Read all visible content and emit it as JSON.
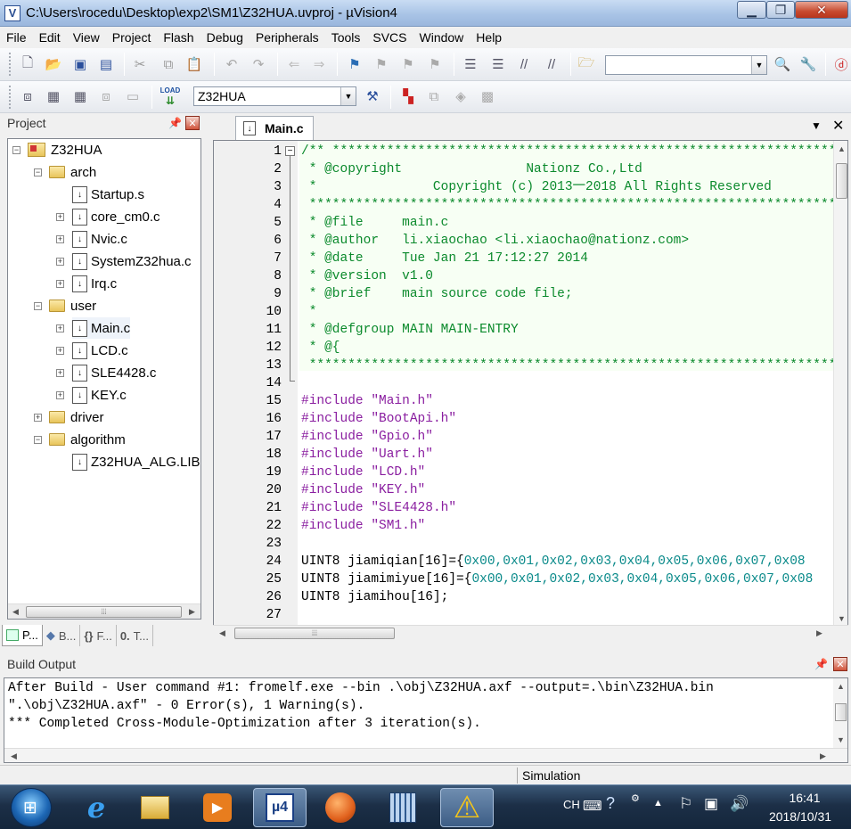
{
  "window": {
    "title": "C:\\Users\\rocedu\\Desktop\\exp2\\SM1\\Z32HUA.uvproj - µVision4",
    "icon_text": "V"
  },
  "menu": [
    "File",
    "Edit",
    "View",
    "Project",
    "Flash",
    "Debug",
    "Peripherals",
    "Tools",
    "SVCS",
    "Window",
    "Help"
  ],
  "toolbar2": {
    "target": "Z32HUA",
    "load_label": "LOAD"
  },
  "project": {
    "title": "Project",
    "tree": [
      {
        "label": "Z32HUA",
        "kind": "root"
      },
      {
        "label": "arch",
        "kind": "folder"
      },
      {
        "label": "Startup.s",
        "kind": "file"
      },
      {
        "label": "core_cm0.c",
        "kind": "file"
      },
      {
        "label": "Nvic.c",
        "kind": "file"
      },
      {
        "label": "SystemZ32hua.c",
        "kind": "file"
      },
      {
        "label": "Irq.c",
        "kind": "file"
      },
      {
        "label": "user",
        "kind": "folder"
      },
      {
        "label": "Main.c",
        "kind": "file"
      },
      {
        "label": "LCD.c",
        "kind": "file"
      },
      {
        "label": "SLE4428.c",
        "kind": "file"
      },
      {
        "label": "KEY.c",
        "kind": "file"
      },
      {
        "label": "driver",
        "kind": "folder"
      },
      {
        "label": "algorithm",
        "kind": "folder"
      },
      {
        "label": "Z32HUA_ALG.LIB",
        "kind": "file"
      }
    ],
    "tabs": [
      "P...",
      "B...",
      "F...",
      "T..."
    ]
  },
  "editor": {
    "tab": "Main.c",
    "lines": [
      {
        "n": "1",
        "t": "/** ***************************************************************************"
      },
      {
        "n": "2",
        "t": " * @copyright                Nationz Co.,Ltd"
      },
      {
        "n": "3",
        "t": " *               Copyright (c) 2013一2018 All Rights Reserved"
      },
      {
        "n": "4",
        "t": " ****************************************************************************"
      },
      {
        "n": "5",
        "t": " * @file     main.c"
      },
      {
        "n": "6",
        "t": " * @author   li.xiaochao <li.xiaochao@nationz.com>"
      },
      {
        "n": "7",
        "t": " * @date     Tue Jan 21 17:12:27 2014"
      },
      {
        "n": "8",
        "t": " * @version  v1.0"
      },
      {
        "n": "9",
        "t": " * @brief    main source code file;"
      },
      {
        "n": "10",
        "t": " *"
      },
      {
        "n": "11",
        "t": " * @defgroup MAIN MAIN-ENTRY"
      },
      {
        "n": "12",
        "t": " * @{"
      },
      {
        "n": "13",
        "t": " ****************************************************************************"
      },
      {
        "n": "14",
        "t": ""
      },
      {
        "n": "15",
        "t": "#include \"Main.h\""
      },
      {
        "n": "16",
        "t": "#include \"BootApi.h\""
      },
      {
        "n": "17",
        "t": "#include \"Gpio.h\""
      },
      {
        "n": "18",
        "t": "#include \"Uart.h\""
      },
      {
        "n": "19",
        "t": "#include \"LCD.h\""
      },
      {
        "n": "20",
        "t": "#include \"KEY.h\""
      },
      {
        "n": "21",
        "t": "#include \"SLE4428.h\""
      },
      {
        "n": "22",
        "t": "#include \"SM1.h\""
      },
      {
        "n": "23",
        "t": ""
      },
      {
        "n": "24",
        "t": "UINT8 jiamiqian[16]={0x00,0x01,0x02,0x03,0x04,0x05,0x06,0x07,0x08"
      },
      {
        "n": "25",
        "t": "UINT8 jiamimiyue[16]={0x00,0x01,0x02,0x03,0x04,0x05,0x06,0x07,0x08"
      },
      {
        "n": "26",
        "t": "UINT8 jiamihou[16];"
      },
      {
        "n": "27",
        "t": ""
      }
    ]
  },
  "build": {
    "title": "Build Output",
    "lines": [
      "After Build - User command #1: fromelf.exe --bin .\\obj\\Z32HUA.axf --output=.\\bin\\Z32HUA.bin",
      "\".\\obj\\Z32HUA.axf\" - 0 Error(s), 1 Warning(s).",
      "*** Completed Cross-Module-Optimization after 3 iteration(s)."
    ]
  },
  "status": {
    "mode": "Simulation"
  },
  "taskbar": {
    "lang": "CH",
    "time": "16:41",
    "date": "2018/10/31"
  },
  "colors": {
    "comment": "#0b8a2c",
    "string": "#8a1ea0",
    "number": "#0a8a8a"
  }
}
